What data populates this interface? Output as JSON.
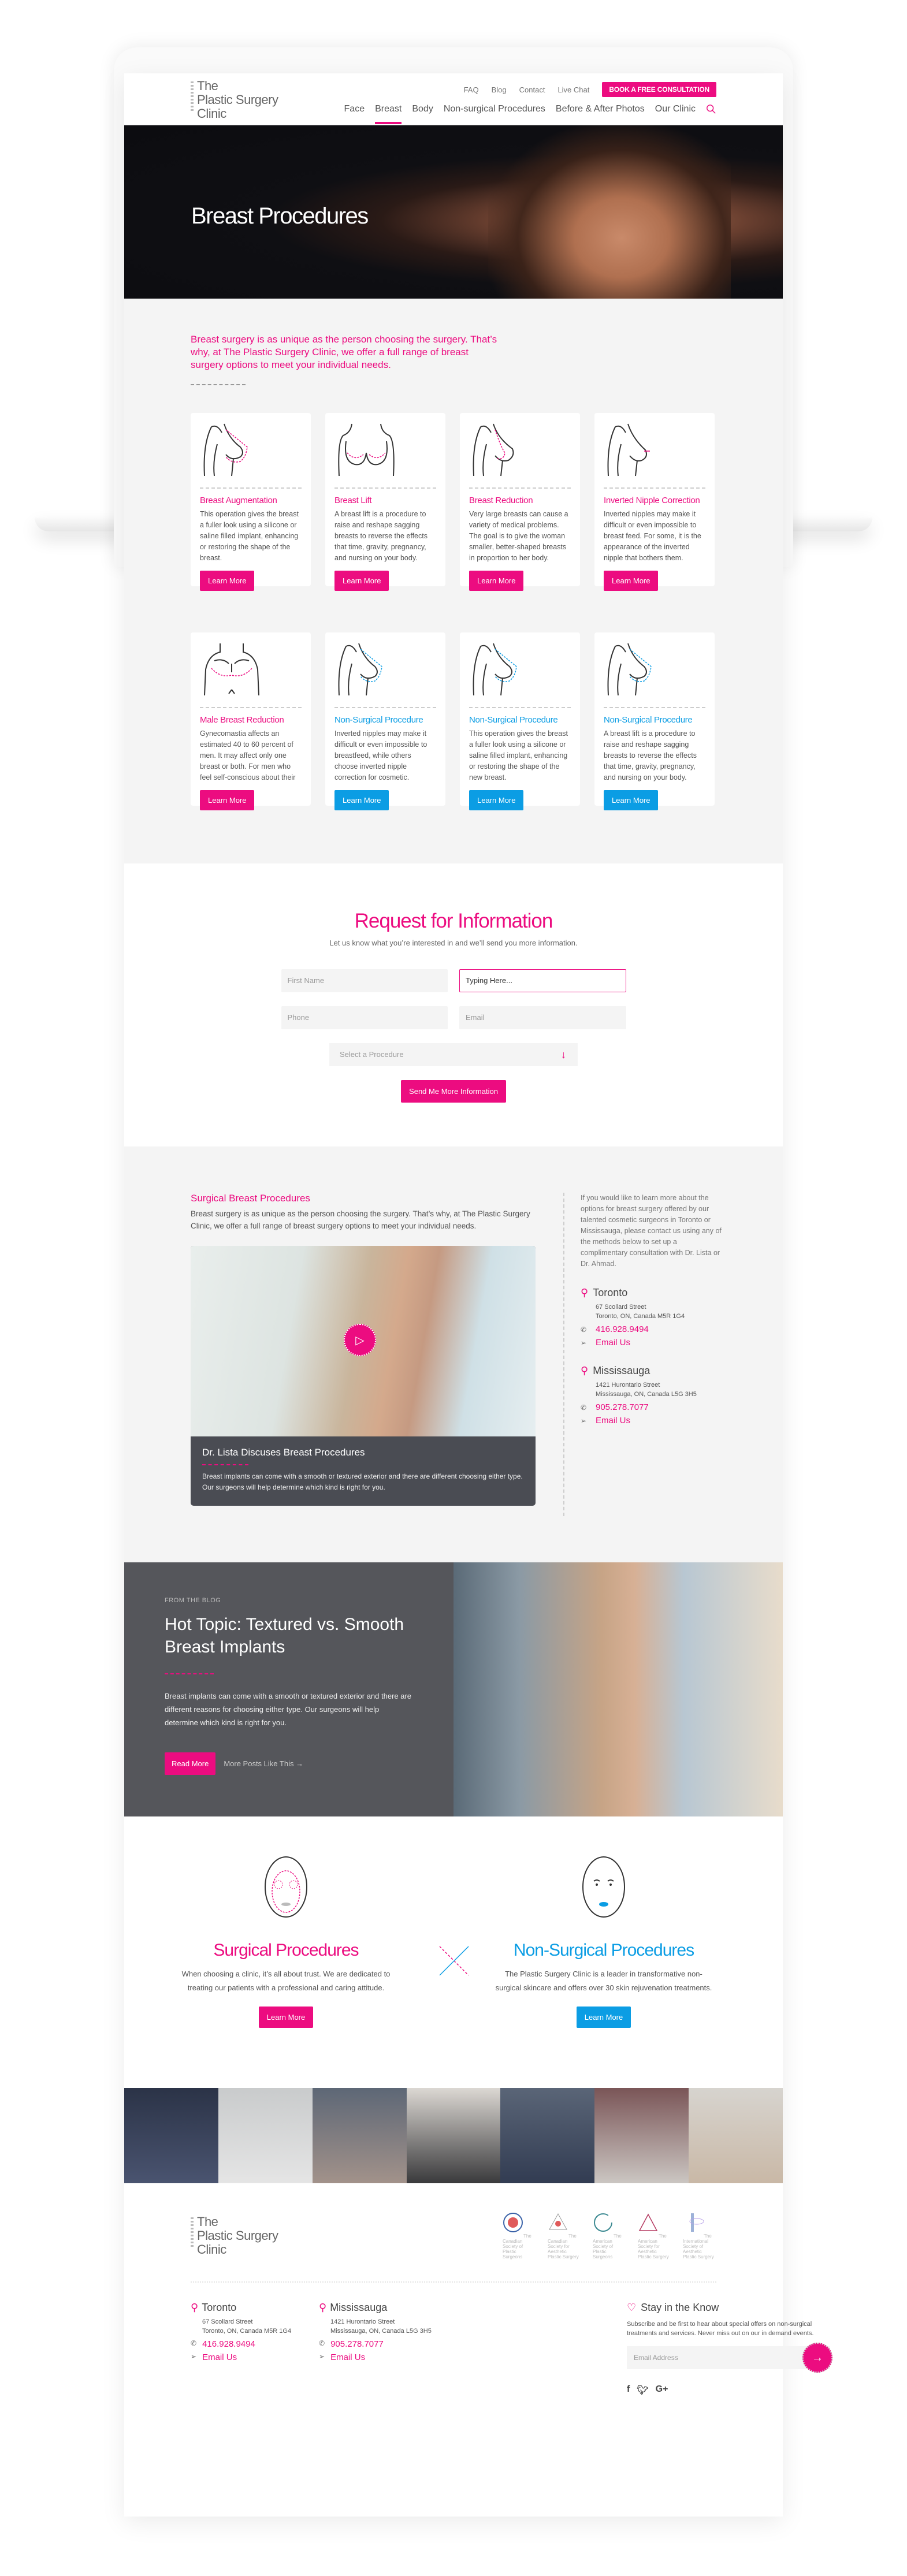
{
  "header": {
    "logo": [
      "The",
      "Plastic Surgery",
      "Clinic"
    ],
    "utility_links": [
      "FAQ",
      "Blog",
      "Contact",
      "Live Chat"
    ],
    "book_button": "BOOK A FREE CONSULTATION",
    "main_nav": [
      "Face",
      "Breast",
      "Body",
      "Non-surgical Procedures",
      "Before & After Photos",
      "Our Clinic"
    ],
    "active_nav": "Breast"
  },
  "hero": {
    "title": "Breast Procedures"
  },
  "intro": {
    "text": "Breast surgery is as unique as the person choosing the surgery. That’s why, at The Plastic Surgery Clinic, we offer a full range of breast surgery options to meet your individual needs."
  },
  "cards": [
    {
      "title": "Breast Augmentation",
      "text": "This operation gives the breast a fuller look using a silicone or saline filled implant, enhancing or restoring the shape of the breast.",
      "button": "Learn More",
      "theme": "pink",
      "icon": "breast-augmentation-icon"
    },
    {
      "title": "Breast Lift",
      "text": "A breast lift is a procedure to raise and reshape sagging breasts to reverse the effects that time, gravity, pregnancy, and nursing on your body.",
      "button": "Learn More",
      "theme": "pink",
      "icon": "breast-lift-icon"
    },
    {
      "title": "Breast Reduction",
      "text": "Very large breasts can cause a variety of medical problems. The goal is to give the woman smaller, better-shaped breasts in proportion to her body.",
      "button": "Learn More",
      "theme": "pink",
      "icon": "breast-reduction-icon"
    },
    {
      "title": "Inverted Nipple Correction",
      "text": "Inverted nipples may make it difficult or even impossible to breast feed. For some, it is the appearance of the inverted nipple that bothers them.",
      "button": "Learn More",
      "theme": "pink",
      "icon": "inverted-nipple-icon"
    },
    {
      "title": "Male Breast Reduction",
      "text": "Gynecomastia affects an estimated 40 to 60 percent of men. It may affect only one breast or both. For men who feel self-conscious about their",
      "button": "Learn More",
      "theme": "pink",
      "icon": "male-chest-icon"
    },
    {
      "title": "Non-Surgical Procedure",
      "text": "Inverted nipples may make it difficult or even impossible to breastfeed, while others choose inverted nipple correction for cosmetic.",
      "button": "Learn More",
      "theme": "blue",
      "icon": "non-surgical-breast-icon"
    },
    {
      "title": "Non-Surgical Procedure",
      "text": "This operation gives the breast a fuller look using a silicone or saline filled implant, enhancing or restoring the shape of the new breast.",
      "button": "Learn More",
      "theme": "blue",
      "icon": "non-surgical-breast-icon"
    },
    {
      "title": "Non-Surgical Procedure",
      "text": "A breast lift is a procedure to raise and reshape sagging breasts to reverse the effects that time, gravity, pregnancy, and nursing on your body.",
      "button": "Learn More",
      "theme": "blue",
      "icon": "non-surgical-breast-icon"
    }
  ],
  "form": {
    "title": "Request for Information",
    "subtitle": "Let us know what you’re interested in and we’ll send you more information.",
    "first_name_placeholder": "First Name",
    "last_name_value": "Typing Here...",
    "phone_placeholder": "Phone",
    "email_placeholder": "Email",
    "procedure_placeholder": "Select a Procedure",
    "submit": "Send Me More Information"
  },
  "surgical": {
    "title": "Surgical Breast Procedures",
    "text": "Breast surgery is as unique as the person choosing the surgery. That’s why, at The Plastic Surgery Clinic, we offer a full range of breast surgery options to meet your individual needs.",
    "video": {
      "title": "Dr. Lista Discuses Breast Procedures",
      "text": "Breast implants can come with a smooth or textured exterior and there are different choosing either type. Our surgeons will help determine which kind is right for you."
    },
    "sidebar_text": "If you would like to learn more about the options for breast surgery offered by our talented cosmetic surgeons in Toronto or Mississauga, please contact us using any of the methods below to set up a complimentary consultation with Dr. Lista or Dr. Ahmad."
  },
  "locations": [
    {
      "city": "Toronto",
      "street": "67 Scollard Street",
      "region": "Toronto, ON, Canada M5R 1G4",
      "phone": "416.928.9494",
      "email": "Email Us"
    },
    {
      "city": "Mississauga",
      "street": "1421 Hurontario Street",
      "region": "Mississauga, ON, Canada L5G 3H5",
      "phone": "905.278.7077",
      "email": "Email Us"
    }
  ],
  "blog": {
    "eyebrow": "FROM THE BLOG",
    "title": "Hot Topic: Textured vs. Smooth Breast Implants",
    "text": "Breast implants can come with a smooth or textured exterior and there are different reasons for choosing either type. Our surgeons will help determine which kind is right for you.",
    "read_more": "Read More",
    "more_posts": "More Posts Like This"
  },
  "split": {
    "surgical": {
      "title": "Surgical Procedures",
      "text": "When choosing a clinic, it’s all about trust. We are dedicated to treating our patients with a professional and caring attitude.",
      "button": "Learn More"
    },
    "non_surgical": {
      "title": "Non-Surgical Procedures",
      "text": "The Plastic Surgery Clinic is a leader in transformative non-surgical skincare and offers over 30 skin rejuvenation treatments.",
      "button": "Learn More"
    }
  },
  "footer": {
    "associations": [
      "The Canadian Society of Plastic Surgeons",
      "The Canadian Society for Aesthetic Plastic Surgery",
      "The American Society of Plastic Surgeons",
      "The American Society for Aesthetic Plastic Surgery",
      "The International Society of Aesthetic Plastic Surgery"
    ],
    "newsletter": {
      "title": "Stay in the Know",
      "text": "Subscribe and be first to hear about special offers on non-surgical treatments and services. Never miss out on our in demand events.",
      "placeholder": "Email Address"
    },
    "social": [
      "f",
      "t",
      "G+"
    ]
  },
  "colors": {
    "pink": "#ec0c80",
    "blue": "#0b9de4",
    "dark": "#55565b",
    "light_bg": "#f4f4f4"
  }
}
